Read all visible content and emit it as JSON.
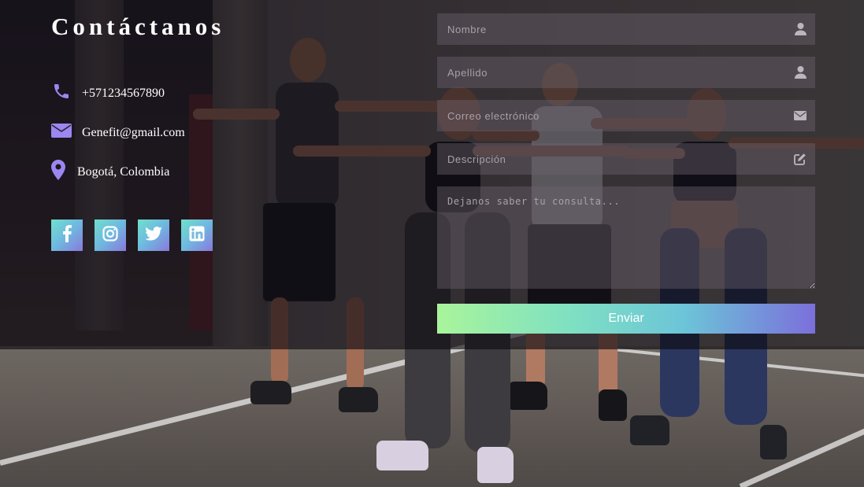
{
  "contact": {
    "title": "Contáctanos",
    "phone": "+571234567890",
    "email": "Genefit@gmail.com",
    "location": "Bogotá, Colombia"
  },
  "social": [
    {
      "name": "facebook-icon"
    },
    {
      "name": "instagram-icon"
    },
    {
      "name": "twitter-icon"
    },
    {
      "name": "linkedin-icon"
    }
  ],
  "form": {
    "first_name_placeholder": "Nombre",
    "last_name_placeholder": "Apellido",
    "email_placeholder": "Correo electrónico",
    "description_placeholder": "Descripción",
    "message_placeholder": "Dejanos saber tu consulta...",
    "submit_label": "Enviar"
  },
  "colors": {
    "icon_accent": "#9b87f0",
    "button_gradient_start": "#a9f59b",
    "button_gradient_end": "#7b6fdb"
  }
}
